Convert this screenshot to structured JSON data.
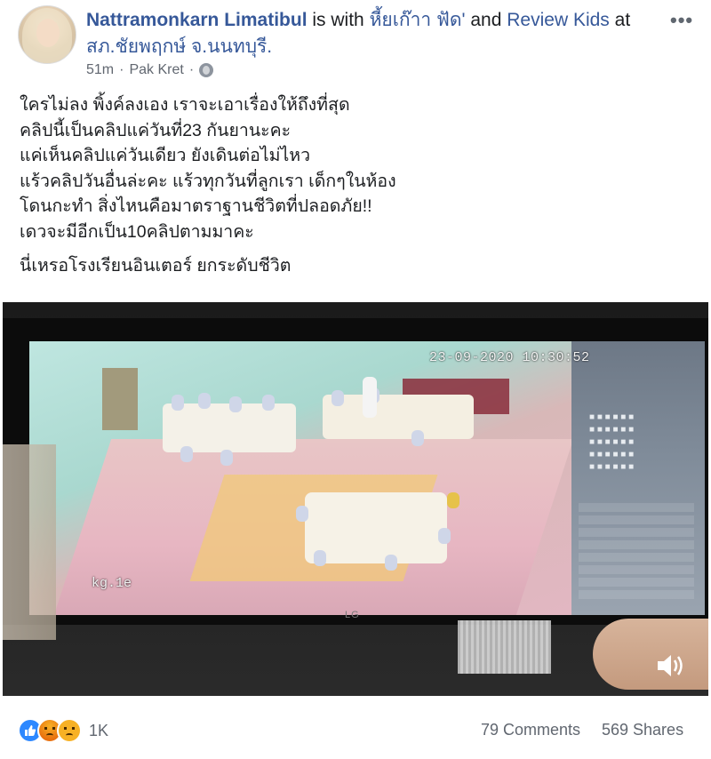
{
  "post": {
    "author": "Nattramonkarn Limatibul",
    "is_with": " is with ",
    "tag1": "หี้ยเก๊าา ฟัด'",
    "and": " and ",
    "tag2": "Review Kids",
    "at": " at",
    "location": "สภ.ชัยพฤกษ์ จ.นนทบุรี.",
    "time": "51m",
    "separator": "·",
    "place": "Pak Kret",
    "privacy_icon": "globe-icon",
    "more_icon": "more-options-icon",
    "more_text": "•••"
  },
  "body": {
    "lines": [
      "ใครไม่ลง พิ้งค์ลงเอง เราจะเอาเรื่องให้ถึงที่สุด",
      "คลิปนี้เป็นคลิปแค่วันที่23 กันยานะคะ",
      "แค่เห็นคลิปแค่วันเดียว ยังเดินต่อไม่ไหว",
      "แร้วคลิปวันอื่นล่ะคะ แร้วทุกวันที่ลูกเรา เด็กๆในห้อง",
      "โดนกะทำ สิ่งไหนคือมาตราฐานชีวิตที่ปลอดภัย!!",
      "เดวจะมีอีกเป็น10คลิปตามมาคะ"
    ],
    "last_line": "นี่เหรอโรงเรียนอินเตอร์ ยกระดับชีวิต"
  },
  "video": {
    "timestamp": "23-09-2020 10:30:52",
    "camera_label": "kg.1e",
    "brand": "LG",
    "mute_icon": "volume-icon"
  },
  "footer": {
    "reaction_icons": [
      "like-icon",
      "angry-icon",
      "sad-icon"
    ],
    "reaction_count": "1K",
    "comments": "79 Comments",
    "shares": "569 Shares"
  },
  "colors": {
    "link": "#365899",
    "meta": "#616770",
    "like": "#2d88ff"
  }
}
